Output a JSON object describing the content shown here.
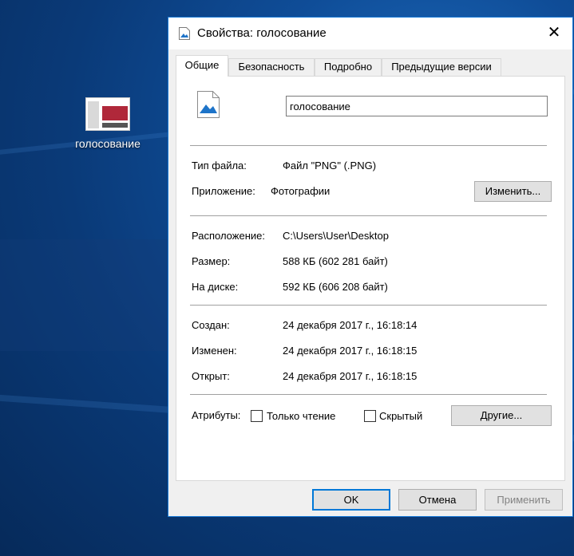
{
  "desktop": {
    "icon_label": "голосование"
  },
  "dialog": {
    "title": "Свойства: голосование",
    "close_glyph": "✕",
    "tabs": [
      {
        "label": "Общие"
      },
      {
        "label": "Безопасность"
      },
      {
        "label": "Подробно"
      },
      {
        "label": "Предыдущие версии"
      }
    ],
    "general": {
      "file_name": "голосование",
      "file_type_label": "Тип файла:",
      "file_type_value": "Файл \"PNG\" (.PNG)",
      "app_label": "Приложение:",
      "app_value": "Фотографии",
      "change_button": "Изменить...",
      "location_label": "Расположение:",
      "location_value": "C:\\Users\\User\\Desktop",
      "size_label": "Размер:",
      "size_value": "588 КБ (602 281 байт)",
      "disk_label": "На диске:",
      "disk_value": "592 КБ (606 208 байт)",
      "created_label": "Создан:",
      "created_value": "24 декабря 2017 г., 16:18:14",
      "modified_label": "Изменен:",
      "modified_value": "24 декабря 2017 г., 16:18:15",
      "opened_label": "Открыт:",
      "opened_value": "24 декабря 2017 г., 16:18:15",
      "attributes_label": "Атрибуты:",
      "readonly_label": "Только чтение",
      "hidden_label": "Скрытый",
      "other_button": "Другие..."
    },
    "buttons": {
      "ok": "OK",
      "cancel": "Отмена",
      "apply": "Применить"
    }
  },
  "colors": {
    "accent": "#0078d7",
    "desktop_bg": "#0a3a78"
  }
}
